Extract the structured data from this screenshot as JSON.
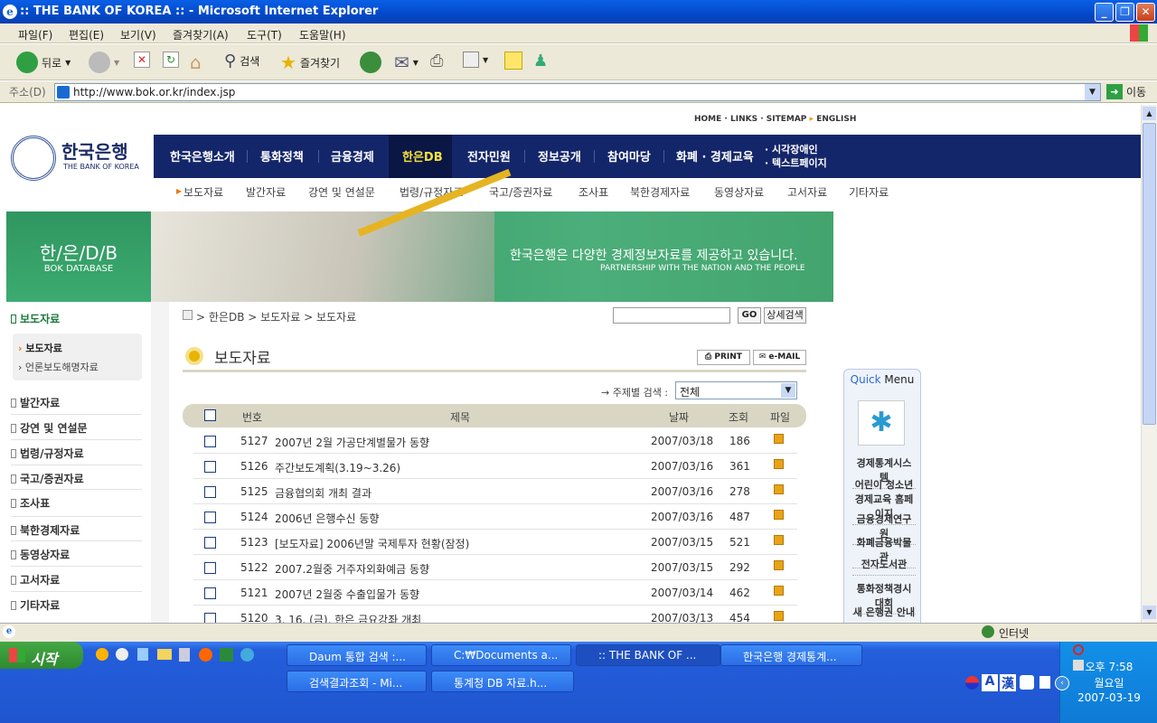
{
  "window": {
    "title": ":: THE BANK OF KOREA :: - Microsoft Internet Explorer"
  },
  "menubar": [
    "파일(F)",
    "편집(E)",
    "보기(V)",
    "즐겨찾기(A)",
    "도구(T)",
    "도움말(H)"
  ],
  "toolbar": {
    "back": "뒤로",
    "search": "검색",
    "favorites": "즐겨찾기"
  },
  "address": {
    "label": "주소(D)",
    "url": "http://www.bok.or.kr/index.jsp",
    "go": "이동"
  },
  "site": {
    "logo_kr": "한국은행",
    "logo_en": "THE BANK OF KOREA",
    "topnav": [
      "HOME",
      "LINKS",
      "SITEMAP",
      "ENGLISH"
    ],
    "mainnav": [
      "한국은행소개",
      "통화정책",
      "금융경제",
      "한은DB",
      "전자민원",
      "정보공개",
      "참여마당",
      "화폐 · 경제교육"
    ],
    "mainnav_extra": [
      "시각장애인",
      "텍스트페이지"
    ],
    "subnav": [
      "보도자료",
      "발간자료",
      "강연 및 연설문",
      "법령/규정자료",
      "국고/증권자료",
      "조사표",
      "북한경제자료",
      "동영상자료",
      "고서자료",
      "기타자료"
    ],
    "banner": {
      "left_kr": "한/은/D/B",
      "left_en": "BOK DATABASE",
      "tagline": "한국은행은 다양한 경제정보자료를 제공하고 있습니다.",
      "tagline_en": "PARTNERSHIP WITH THE NATION AND THE PEOPLE"
    },
    "leftnav": {
      "title": "보도자료",
      "sub": [
        "보도자료",
        "언론보도해명자료"
      ],
      "items": [
        "발간자료",
        "강연 및 연설문",
        "법령/규정자료",
        "국고/증권자료",
        "조사표",
        "북한경제자료",
        "동영상자료",
        "고서자료",
        "기타자료"
      ]
    },
    "breadcrumb": "> 한은DB > 보도자료 > 보도자료",
    "search": {
      "go": "GO",
      "detail": "상세검색"
    },
    "content": {
      "title": "보도자료",
      "print": "PRINT",
      "email": "e-MAIL",
      "filter_label": "주제별 검색 :",
      "filter_value": "전체"
    },
    "table": {
      "headers": [
        "번호",
        "제목",
        "날짜",
        "조회",
        "파일"
      ],
      "rows": [
        [
          "5127",
          "2007년 2월 가공단계별물가 동향",
          "2007/03/18",
          "186"
        ],
        [
          "5126",
          "주간보도계획(3.19~3.26)",
          "2007/03/16",
          "361"
        ],
        [
          "5125",
          "금융협의회 개최 결과",
          "2007/03/16",
          "278"
        ],
        [
          "5124",
          "2006년 은행수신 동향",
          "2007/03/16",
          "487"
        ],
        [
          "5123",
          "[보도자료] 2006년말 국제투자 현황(잠정)",
          "2007/03/15",
          "521"
        ],
        [
          "5122",
          "2007.2월중 거주자외화예금 동향",
          "2007/03/15",
          "292"
        ],
        [
          "5121",
          "2007년 2월중 수출입물가 동향",
          "2007/03/14",
          "462"
        ],
        [
          "5120",
          "3. 16. (금), 한은 금요강좌 개최",
          "2007/03/13",
          "454"
        ]
      ]
    },
    "quickmenu": {
      "title_a": "Quick",
      "title_b": "Menu",
      "items": [
        "경제통계시스템",
        "어린이 청소년 경제교육 홈페이지",
        "금융경제연구원",
        "화폐금융박물관",
        "전자도서관",
        "통화정책경시대회",
        "새 은행권 안내"
      ]
    }
  },
  "statusbar": {
    "zone": "인터넷"
  },
  "taskbar": {
    "start": "시작",
    "tasks": [
      "Daum 통합 검색 :...",
      "C:₩Documents a...",
      ":: THE BANK OF ...",
      "한국은행 경제통계...",
      "검색결과조회 - Mi...",
      "통계청 DB 자료.h..."
    ],
    "clock": {
      "time": "오후 7:58",
      "day": "월요일",
      "date": "2007-03-19"
    },
    "ime": [
      "A",
      "漢"
    ]
  }
}
